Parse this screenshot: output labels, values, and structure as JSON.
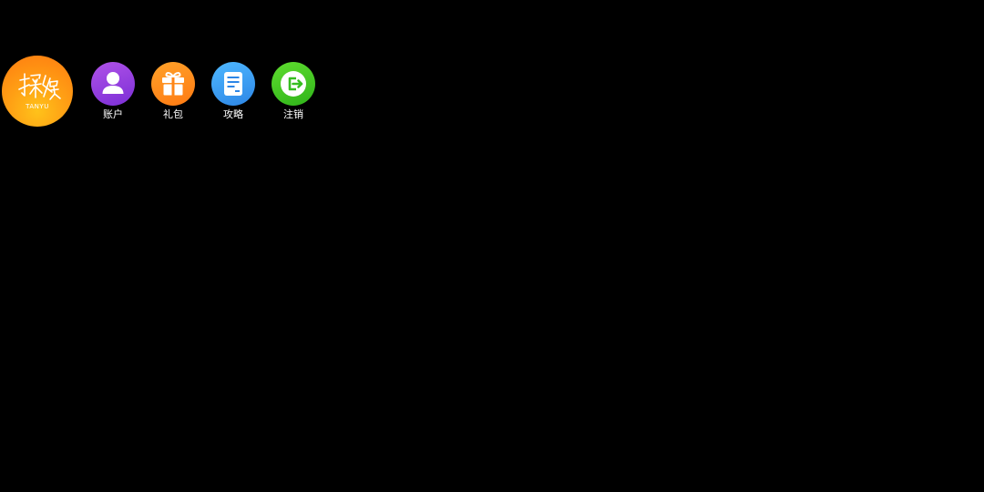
{
  "logo": {
    "text_main": "探娱",
    "text_sub": "TANYU",
    "colors": {
      "inner": "#ffc21a",
      "outer": "#ff7a10"
    }
  },
  "menu": {
    "items": [
      {
        "label": "账户",
        "icon": "user-icon",
        "color": "#9340e0"
      },
      {
        "label": "礼包",
        "icon": "gift-icon",
        "color": "#ff8c1a"
      },
      {
        "label": "攻略",
        "icon": "document-icon",
        "color": "#3a9cf0"
      },
      {
        "label": "注销",
        "icon": "logout-icon",
        "color": "#3fc424"
      }
    ]
  }
}
